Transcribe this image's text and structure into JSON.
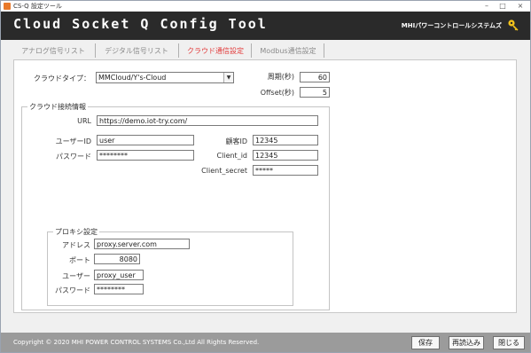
{
  "window": {
    "title": "CS-Q 設定ツール",
    "app_title": "Cloud Socket Q Config Tool",
    "company": "MHIパワーコントロールシステムズ"
  },
  "tabs": [
    {
      "label": "アナログ信号リスト"
    },
    {
      "label": "デジタル信号リスト"
    },
    {
      "label": "クラウド通信設定"
    },
    {
      "label": "Modbus通信設定"
    }
  ],
  "cloud_type": {
    "label": "クラウドタイプ：",
    "value": "MMCloud/Y's-Cloud"
  },
  "period": {
    "label": "周期(秒)",
    "value": "60"
  },
  "offset": {
    "label": "Offset(秒)",
    "value": "5"
  },
  "connection": {
    "group_label": "クラウド接続情報",
    "url_label": "URL",
    "url": "https://demo.iot-try.com/",
    "user_label": "ユーザーID",
    "user": "user",
    "password_label": "パスワード",
    "password": "********",
    "customer_label": "顧客ID",
    "customer": "12345",
    "client_id_label": "Client_id",
    "client_id": "12345",
    "client_secret_label": "Client_secret",
    "client_secret": "*****"
  },
  "proxy": {
    "group_label": "プロキシ設定",
    "address_label": "アドレス",
    "address": "proxy.server.com",
    "port_label": "ポート",
    "port": "8080",
    "user_label": "ユーザー",
    "user": "proxy_user",
    "password_label": "パスワード",
    "password": "********"
  },
  "footer": {
    "copyright": "Copyright © 2020 MHI POWER CONTROL SYSTEMS Co.,Ltd All Rights Reserved.",
    "save": "保存",
    "reload": "再読込み",
    "close": "閉じる"
  },
  "colors": {
    "header": "#2a2a2a",
    "active_tab": "#e23c3c",
    "footer": "#9b9b9b",
    "key_icon": "#f2c21b"
  }
}
